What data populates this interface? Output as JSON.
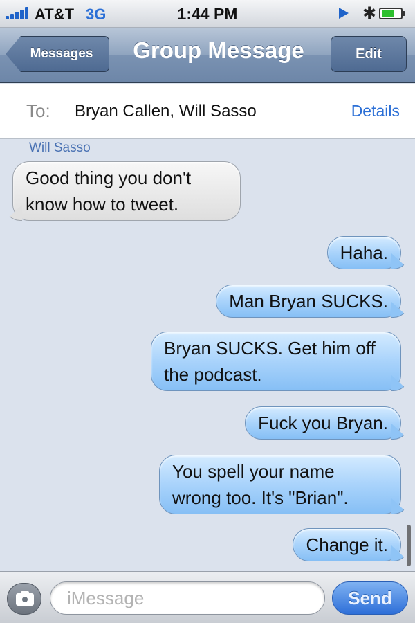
{
  "status_bar": {
    "carrier": "AT&T",
    "network": "3G",
    "time": "1:44 PM",
    "icons": [
      "signal-bars-icon",
      "location-arrow-icon",
      "bluetooth-icon",
      "battery-icon"
    ]
  },
  "nav": {
    "back_label": "Messages",
    "title": "Group Message",
    "edit_label": "Edit"
  },
  "recipients": {
    "to_label": "To:",
    "names": "Bryan Callen, Will Sasso",
    "details_label": "Details"
  },
  "conversation": {
    "sender_name": "Will Sasso",
    "messages": [
      {
        "direction": "incoming",
        "text": "Good thing you don't know how to tweet."
      },
      {
        "direction": "outgoing",
        "text": "Haha."
      },
      {
        "direction": "outgoing",
        "text": "Man Bryan SUCKS."
      },
      {
        "direction": "outgoing",
        "text": "Bryan SUCKS.  Get him off the podcast."
      },
      {
        "direction": "outgoing",
        "text": "Fuck you Bryan."
      },
      {
        "direction": "outgoing",
        "text": "You spell your name wrong too. It's \"Brian\"."
      },
      {
        "direction": "outgoing",
        "text": "Change it."
      }
    ]
  },
  "composer": {
    "placeholder": "iMessage",
    "value": "",
    "send_label": "Send"
  },
  "colors": {
    "outgoing_bubble": "#a9d3fb",
    "incoming_bubble": "#e9e9e9",
    "background": "#dbe2ed",
    "accent": "#2b6fd6"
  }
}
